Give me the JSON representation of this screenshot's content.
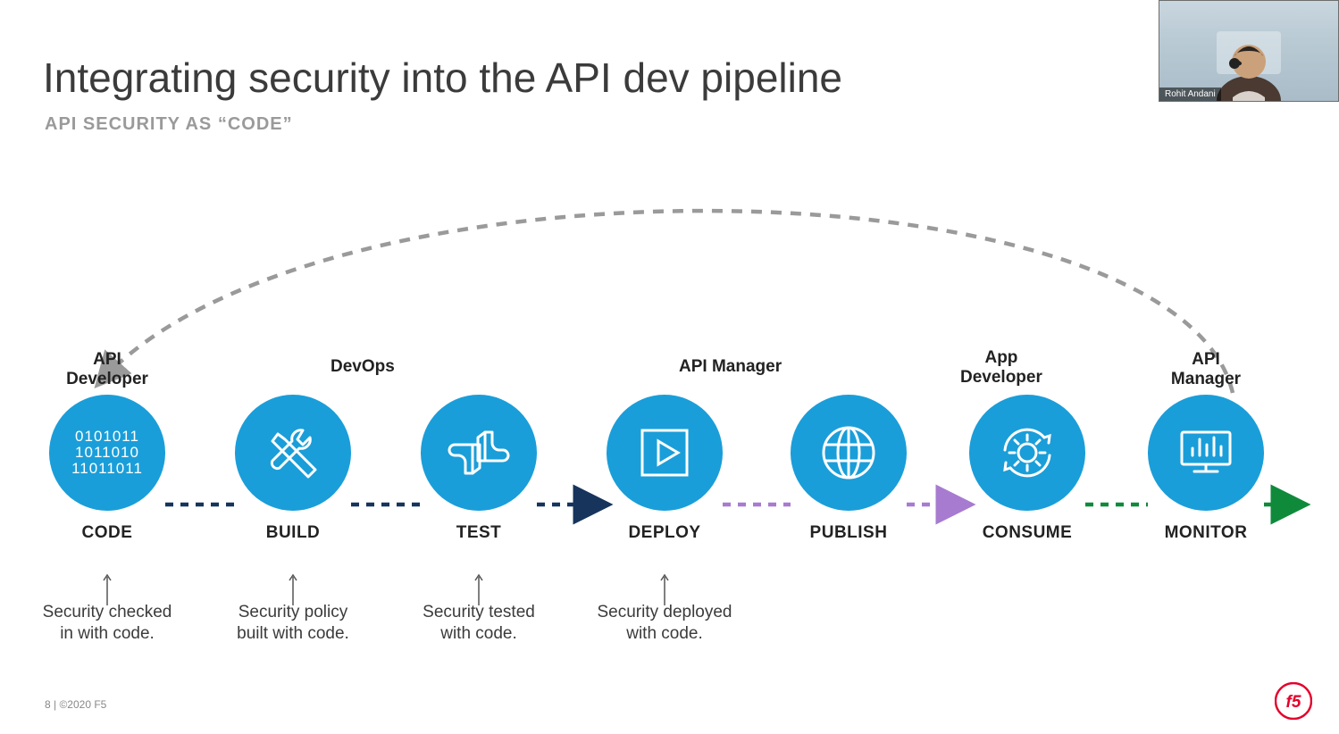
{
  "title": "Integrating security into the API dev pipeline",
  "subtitle": "API SECURITY AS “CODE”",
  "footer": "8 | ©2020 F5",
  "presenter": "Rohit Andani",
  "colors": {
    "circle": "#1a9ed9",
    "dashNavy": "#16345c",
    "dashPurple": "#a77bd0",
    "dashGreen": "#0f8a3b",
    "feedback": "#9a9a9a"
  },
  "nodes": [
    {
      "role": "API\nDeveloper",
      "step": "CODE",
      "note": "Security checked\nin with code.",
      "out": "navy"
    },
    {
      "role": "",
      "step": "BUILD",
      "note": "Security policy\nbuilt with code.",
      "out": "navy"
    },
    {
      "role": "DevOps",
      "step": "TEST",
      "note": "Security tested\nwith code.",
      "out": "navy"
    },
    {
      "role": "",
      "step": "DEPLOY",
      "note": "Security deployed\nwith code.",
      "out": "purple"
    },
    {
      "role": "API Manager",
      "step": "PUBLISH",
      "note": "",
      "out": "purple"
    },
    {
      "role": "",
      "step": "CONSUME",
      "note": "",
      "out": "green"
    },
    {
      "role": "App\nDeveloper",
      "step": "",
      "note": "",
      "out": ""
    },
    {
      "role": "API\nManager",
      "step": "MONITOR",
      "note": "",
      "out": "green"
    }
  ],
  "x": [
    90,
    300,
    508,
    715,
    920,
    1120,
    0,
    1320
  ],
  "roleOffset": [
    0,
    0,
    150,
    0,
    230,
    0,
    1090,
    0
  ]
}
